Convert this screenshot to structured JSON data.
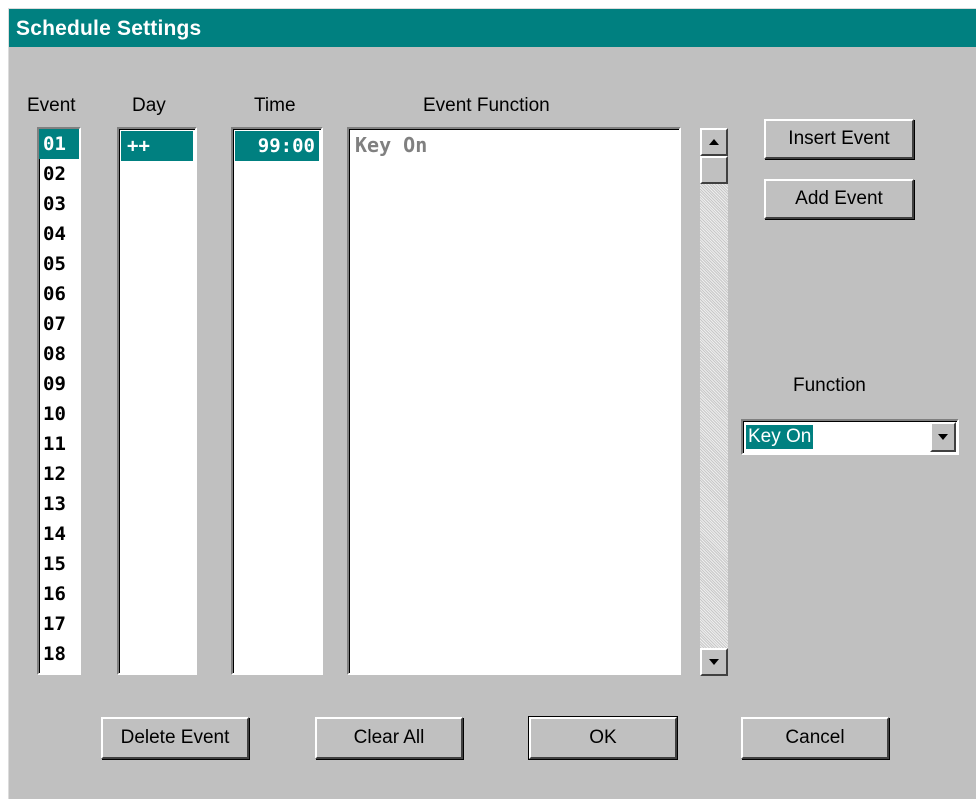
{
  "window": {
    "title": "Schedule Settings"
  },
  "columns": {
    "event": "Event",
    "day": "Day",
    "time": "Time",
    "event_function": "Event Function"
  },
  "events": [
    "01",
    "02",
    "03",
    "04",
    "05",
    "06",
    "07",
    "08",
    "09",
    "10",
    "11",
    "12",
    "13",
    "14",
    "15",
    "16",
    "17",
    "18"
  ],
  "selected_event": "01",
  "day_value": "++",
  "time_value": "99:00",
  "event_function_value": "Key On",
  "buttons": {
    "insert_event": "Insert Event",
    "add_event": "Add Event",
    "delete_event": "Delete Event",
    "clear_all": "Clear All",
    "ok": "OK",
    "cancel": "Cancel"
  },
  "function": {
    "label": "Function",
    "selected": "Key On"
  },
  "colors": {
    "title_bar": "#008080",
    "selection": "#008080",
    "dialog_bg": "#c0c0c0"
  }
}
